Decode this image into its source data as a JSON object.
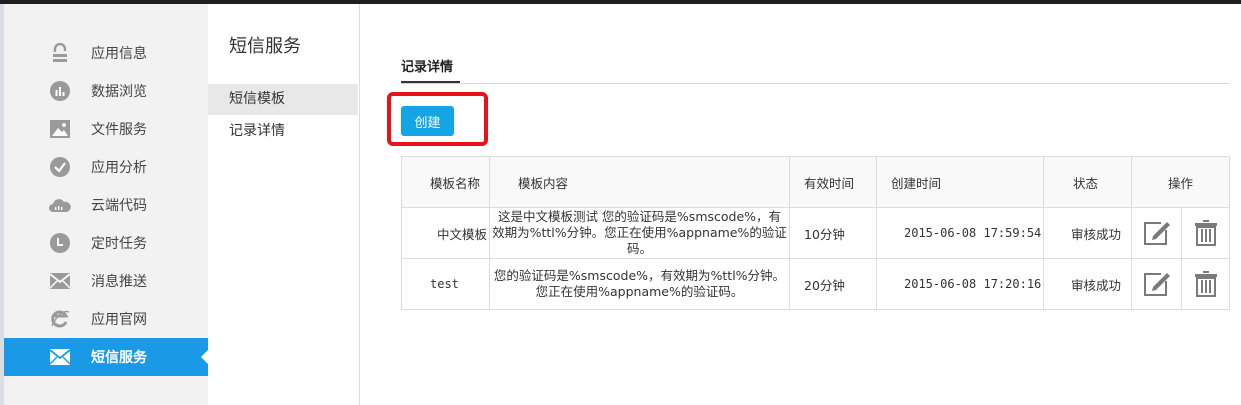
{
  "sidebar": {
    "items": [
      {
        "label": "应用信息",
        "icon": "lock-icon"
      },
      {
        "label": "数据浏览",
        "icon": "chart-icon"
      },
      {
        "label": "文件服务",
        "icon": "image-icon"
      },
      {
        "label": "应用分析",
        "icon": "check-icon"
      },
      {
        "label": "云端代码",
        "icon": "cloud-icon"
      },
      {
        "label": "定时任务",
        "icon": "clock-icon"
      },
      {
        "label": "消息推送",
        "icon": "mail-icon"
      },
      {
        "label": "应用官网",
        "icon": "ie-icon"
      },
      {
        "label": "短信服务",
        "icon": "sms-icon"
      }
    ],
    "active_index": 8
  },
  "subnav": {
    "title": "短信服务",
    "items": [
      "短信模板",
      "记录详情"
    ],
    "active_index": 0
  },
  "main": {
    "section_title": "记录详情",
    "create_label": "创建",
    "table": {
      "headers": [
        "模板名称",
        "模板内容",
        "有效时间",
        "创建时间",
        "状态",
        "操作"
      ],
      "rows": [
        {
          "name": "中文模板",
          "content": "这是中文模板测试 您的验证码是%smscode%，有效期为%ttl%分钟。您正在使用%appname%的验证码。",
          "valid": "10分钟",
          "created": "2015-06-08 17:59:54",
          "status": "审核成功"
        },
        {
          "name": "test",
          "content": "您的验证码是%smscode%，有效期为%ttl%分钟。您正在使用%appname%的验证码。",
          "valid": "20分钟",
          "created": "2015-06-08 17:20:16",
          "status": "审核成功"
        }
      ]
    }
  },
  "colors": {
    "accent": "#1a9ae6",
    "button": "#15a5e6",
    "highlight": "#e8121a",
    "sidebar_bg": "#f2f2f2"
  }
}
